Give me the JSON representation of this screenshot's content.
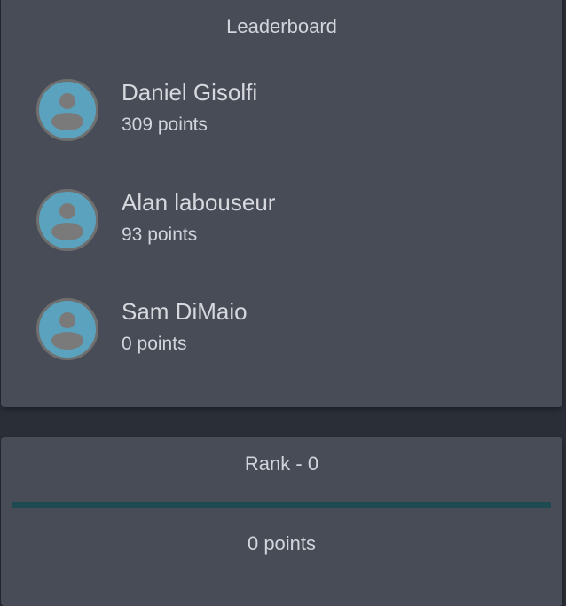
{
  "leaderboard": {
    "title": "Leaderboard",
    "entries": [
      {
        "name": "Daniel Gisolfi",
        "points": "309 points",
        "avatar_icon": "user-avatar-icon"
      },
      {
        "name": "Alan labouseur",
        "points": "93 points",
        "avatar_icon": "user-avatar-icon"
      },
      {
        "name": "Sam DiMaio",
        "points": "0 points",
        "avatar_icon": "user-avatar-icon"
      }
    ]
  },
  "rank": {
    "title": "Rank - 0",
    "progress_fraction": 0,
    "points": "0 points"
  },
  "colors": {
    "background": "#2a2e37",
    "card": "#474c57",
    "text": "#d2d5db",
    "avatar_fill": "#5aa2bd",
    "avatar_border": "#6f6f6f",
    "progress_track": "#1e4a52"
  }
}
